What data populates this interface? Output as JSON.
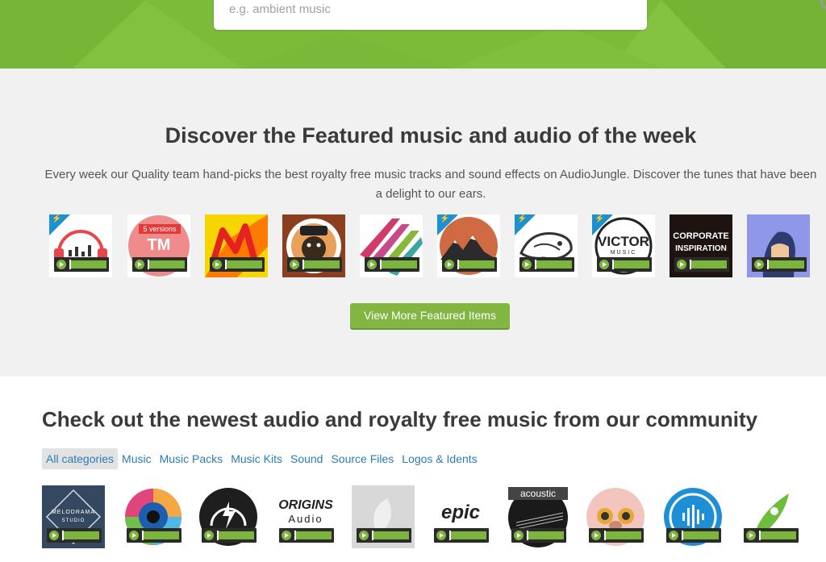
{
  "search": {
    "placeholder": "e.g. ambient music"
  },
  "featured": {
    "title": "Discover the Featured music and audio of the week",
    "description": "Every week our Quality team hand-picks the best royalty free music tracks and sound effects on AudioJungle. Discover the tunes that have been a delight to our ears.",
    "view_more_label": "View More Featured Items",
    "items": [
      {
        "icon": "headphones-icon",
        "badge": true
      },
      {
        "icon": "tm-logo-icon",
        "badge": false,
        "text_top": "5 versions",
        "text_main": "TM"
      },
      {
        "icon": "m-logo-icon",
        "badge": false
      },
      {
        "icon": "bear-captain-icon",
        "badge": false
      },
      {
        "icon": "stripes-icon",
        "badge": false
      },
      {
        "icon": "mountains-icon",
        "badge": true
      },
      {
        "icon": "whale-icon",
        "badge": true
      },
      {
        "icon": "victor-logo-icon",
        "badge": true,
        "text_main": "VICTOR",
        "text_sub": "MUSIC"
      },
      {
        "icon": "corporate-inspiration-icon",
        "badge": false,
        "text_main": "CORPORATE",
        "text_sub": "INSPIRATION"
      },
      {
        "icon": "bearded-man-icon",
        "badge": false
      }
    ]
  },
  "newest": {
    "title": "Check out the newest audio and royalty free music from our community",
    "categories": [
      "All categories",
      "Music",
      "Music Packs",
      "Music Kits",
      "Sound",
      "Source Files",
      "Logos & Idents"
    ],
    "items": [
      {
        "icon": "melodrama-studio-icon",
        "text_main": "MELODRAMA",
        "text_sub": "STUDIO"
      },
      {
        "icon": "eye-vinyl-icon"
      },
      {
        "icon": "lightning-headphones-icon"
      },
      {
        "icon": "origins-audio-icon",
        "text_main": "ORIGINS",
        "text_sub": "Audio"
      },
      {
        "icon": "leaf-placeholder-icon"
      },
      {
        "icon": "epic-logo-icon",
        "text_main": "epic"
      },
      {
        "icon": "acoustic-guitar-icon",
        "text_main": "acoustic"
      },
      {
        "icon": "bear-headphones-icon"
      },
      {
        "icon": "soundwave-circle-icon"
      },
      {
        "icon": "rocket-icon"
      }
    ]
  },
  "colors": {
    "hero_green": "#7cbb3a",
    "button_green": "#82b541",
    "link_blue": "#2c7cb6",
    "badge_blue": "#1e8fd1"
  }
}
